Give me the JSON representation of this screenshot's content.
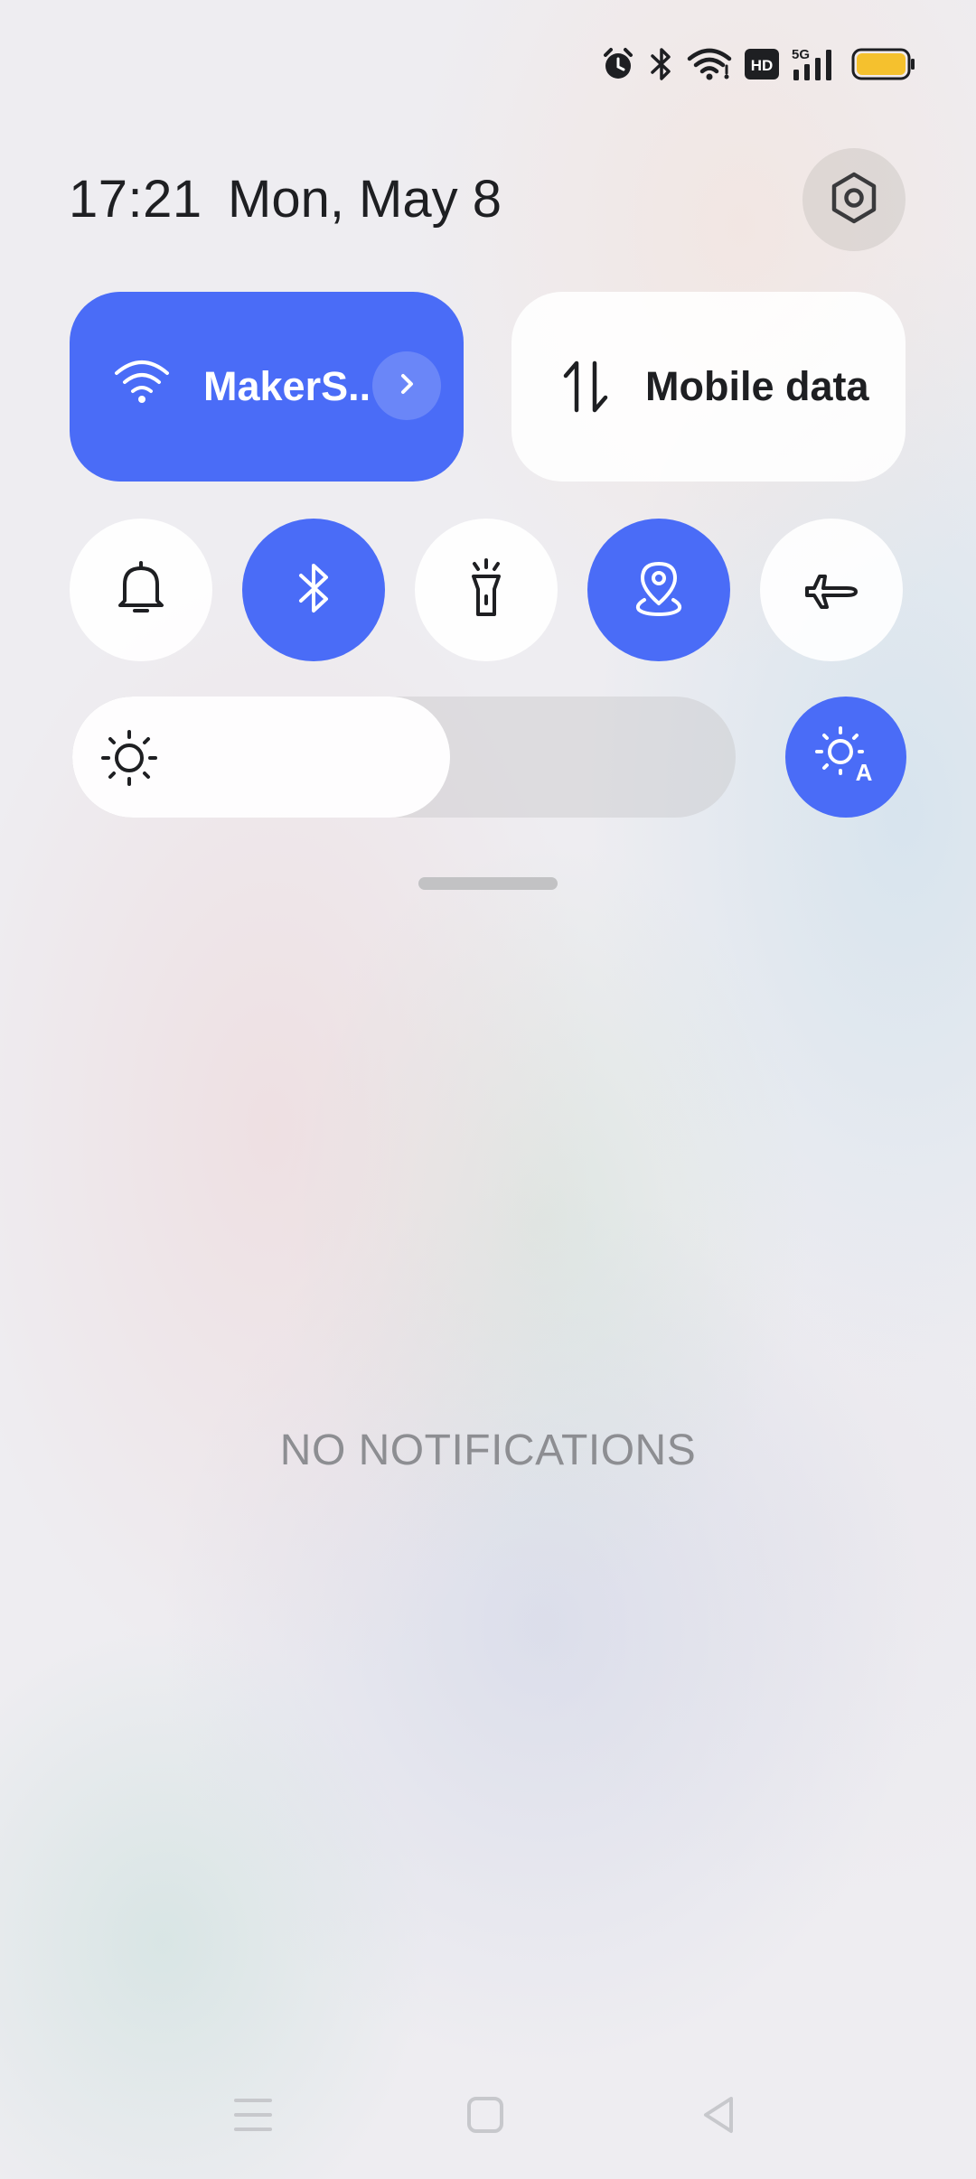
{
  "status_bar": {
    "icons": [
      "alarm-icon",
      "bluetooth-icon",
      "wifi-icon",
      "hd-icon",
      "5g-signal-icon",
      "battery-icon"
    ],
    "hd_label": "HD",
    "network_label": "5G",
    "battery_color": "#f5c12e"
  },
  "header": {
    "time": "17:21",
    "date": "Mon, May 8",
    "settings_icon": "gear-icon"
  },
  "tiles": {
    "wifi": {
      "label": "MakerS..",
      "active": true,
      "icon": "wifi-icon"
    },
    "mobile_data": {
      "label": "Mobile data",
      "active": false,
      "icon": "mobile-data-icon"
    }
  },
  "toggles": [
    {
      "name": "sound",
      "icon": "bell-icon",
      "active": false
    },
    {
      "name": "bluetooth",
      "icon": "bluetooth-icon",
      "active": true
    },
    {
      "name": "flashlight",
      "icon": "flashlight-icon",
      "active": false
    },
    {
      "name": "location",
      "icon": "location-icon",
      "active": true
    },
    {
      "name": "airplane-mode",
      "icon": "airplane-icon",
      "active": false
    }
  ],
  "brightness": {
    "level_percent": 57,
    "auto": true,
    "auto_badge": "A"
  },
  "notifications": {
    "empty_text": "NO NOTIFICATIONS"
  },
  "nav_bar": [
    "menu-icon",
    "home-icon",
    "back-icon"
  ],
  "colors": {
    "accent": "#4a6cf7",
    "text": "#1e1f22",
    "muted": "#8d8e92"
  }
}
